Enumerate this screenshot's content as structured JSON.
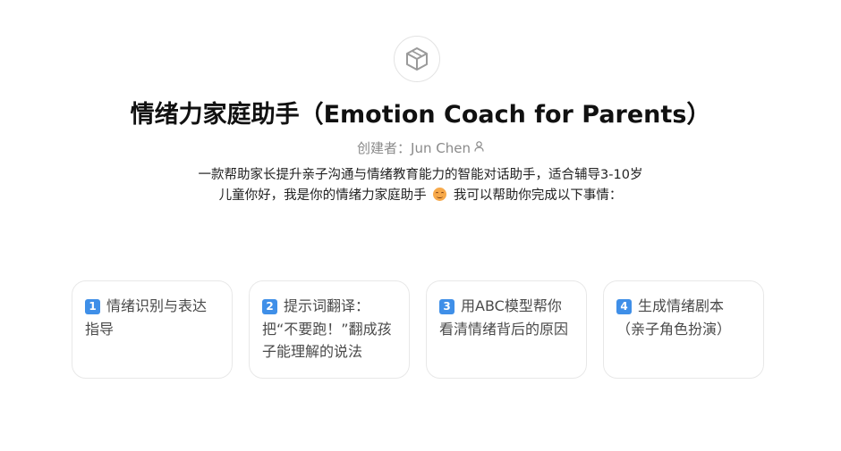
{
  "bot": {
    "avatar_icon": "cube-icon",
    "title": "情绪力家庭助手（Emotion Coach for Parents）",
    "creator_label": "创建者：",
    "creator_name": "Jun Chen",
    "creator_icon": "user-icon",
    "description_before_emoji": "一款帮助家长提升亲子沟通与情绪教育能力的智能对话助手，适合辅导3-10岁儿童你好，我是你的情绪力家庭助手",
    "emoji_icon": "smiling-face-icon",
    "description_after_emoji": "我可以帮助你完成以下事情："
  },
  "suggestions": [
    {
      "number": "1",
      "text": "情绪识别与表达指导"
    },
    {
      "number": "2",
      "text": "提示词翻译：把“不要跑！”翻成孩子能理解的说法"
    },
    {
      "number": "3",
      "text": "用ABC模型帮你看清情绪背后的原因"
    },
    {
      "number": "4",
      "text": "生成情绪剧本（亲子角色扮演）"
    }
  ],
  "colors": {
    "badge": "#3f8fe8",
    "card_border": "#e8e8e8",
    "muted_text": "#8a8a8a"
  }
}
